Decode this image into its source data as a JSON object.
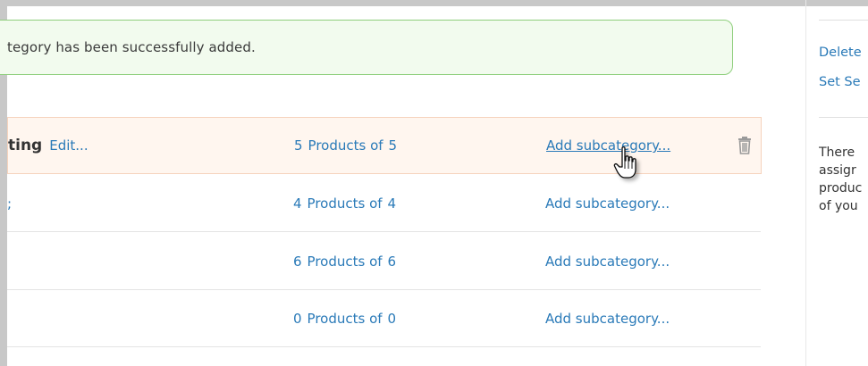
{
  "alert": {
    "message": "tegory has been successfully added."
  },
  "categories": [
    {
      "name_visible": "ting",
      "edit_label": "Edit...",
      "products_count": "5",
      "products_text": "Products of",
      "products_total": "5",
      "add_sub_label": "Add subcategory..."
    },
    {
      "name_visible": ";",
      "products_count": "4",
      "products_text": "Products of",
      "products_total": "4",
      "add_sub_label": "Add subcategory..."
    },
    {
      "name_visible": "",
      "products_count": "6",
      "products_text": "Products of",
      "products_total": "6",
      "add_sub_label": "Add subcategory..."
    },
    {
      "name_visible": "",
      "products_count": "0",
      "products_text": "Products of",
      "products_total": "0",
      "add_sub_label": "Add subcategory..."
    }
  ],
  "sidebar": {
    "delete_link": "Delete",
    "set_link": "Set Se",
    "info_lines": [
      "There",
      "assigr",
      "produc",
      "of you"
    ]
  },
  "colors": {
    "link": "#2a7ab8",
    "alert_bg": "#f2fbee",
    "alert_border": "#8fcf7d",
    "highlight_bg": "#fff6ef"
  },
  "icons": {
    "delete": "trash-icon",
    "pointer": "hand-cursor-icon"
  }
}
